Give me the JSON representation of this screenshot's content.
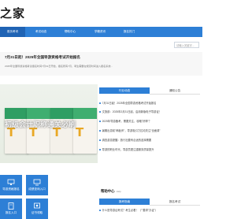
{
  "site": {
    "logo": "之家"
  },
  "nav": {
    "items": [
      "首页考讯",
      "考试动态",
      "帮助中心",
      "学籍资讯",
      "报名热门"
    ]
  },
  "search": {
    "placeholder": "请输入关键字..."
  },
  "notice": {
    "title": "7月31日起！2025年全国导游资格考试开始报名",
    "desc": "2025年全国导游资格考试报名时间7月31日开始，报名所有7月，考生需要在规定时间进入报名系统..."
  },
  "promo": {
    "text": "初级会计职称通关必刷",
    "book_num": "T"
  },
  "news_tabs": {
    "tab1": "行业动态",
    "tab2": "通知公告"
  },
  "news": [
    "7月31日起！2025年全国导游资格考试开始报名",
    "文旅部：2025年2月31日起，启用新版电子导游证！",
    "2025年导游备考，需要关注，攻略\"好神\"？",
    "暑期出游前\"两板斧\"，导游吸引力拉动关注\"全面调\"",
    "调查游游提醒：旅行社要有合适的选择需要",
    "导游的职业时代，导游员更注重服务质量提升"
  ],
  "help": {
    "title": "帮助中心",
    "eng": "Help"
  },
  "help_tabs": {
    "tab1": "报考指南",
    "tab2": "报名考试"
  },
  "help_list": [
    "什么是导游证考试？考生必看！（\"\"要求\"办证\"）",
    "教育了解：全国导游资格考试报名【2025版】（全国指南）",
    "报名全国导游资格考试所需要的资料（必看指南）"
  ],
  "services": [
    {
      "label": "导游资格报名"
    },
    {
      "label": "成绩查询入口"
    },
    {
      "label": "报名入口"
    },
    {
      "label": "证书领取"
    }
  ]
}
